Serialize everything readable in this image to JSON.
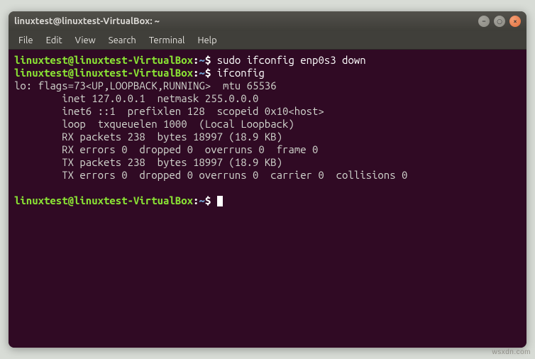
{
  "window": {
    "title": "linuxtest@linuxtest-VirtualBox: ~"
  },
  "menubar": {
    "items": [
      "File",
      "Edit",
      "View",
      "Search",
      "Terminal",
      "Help"
    ]
  },
  "prompt": {
    "userhost": "linuxtest@linuxtest-VirtualBox",
    "sep": ":",
    "path": "~",
    "sigil": "$"
  },
  "session": {
    "cmd1": "sudo ifconfig enp0s3 down",
    "cmd2": "ifconfig",
    "output_lines": [
      "lo: flags=73<UP,LOOPBACK,RUNNING>  mtu 65536",
      "        inet 127.0.0.1  netmask 255.0.0.0",
      "        inet6 ::1  prefixlen 128  scopeid 0x10<host>",
      "        loop  txqueuelen 1000  (Local Loopback)",
      "        RX packets 238  bytes 18997 (18.9 KB)",
      "        RX errors 0  dropped 0  overruns 0  frame 0",
      "        TX packets 238  bytes 18997 (18.9 KB)",
      "        TX errors 0  dropped 0 overruns 0  carrier 0  collisions 0"
    ]
  },
  "watermark": "wsxdn.com"
}
